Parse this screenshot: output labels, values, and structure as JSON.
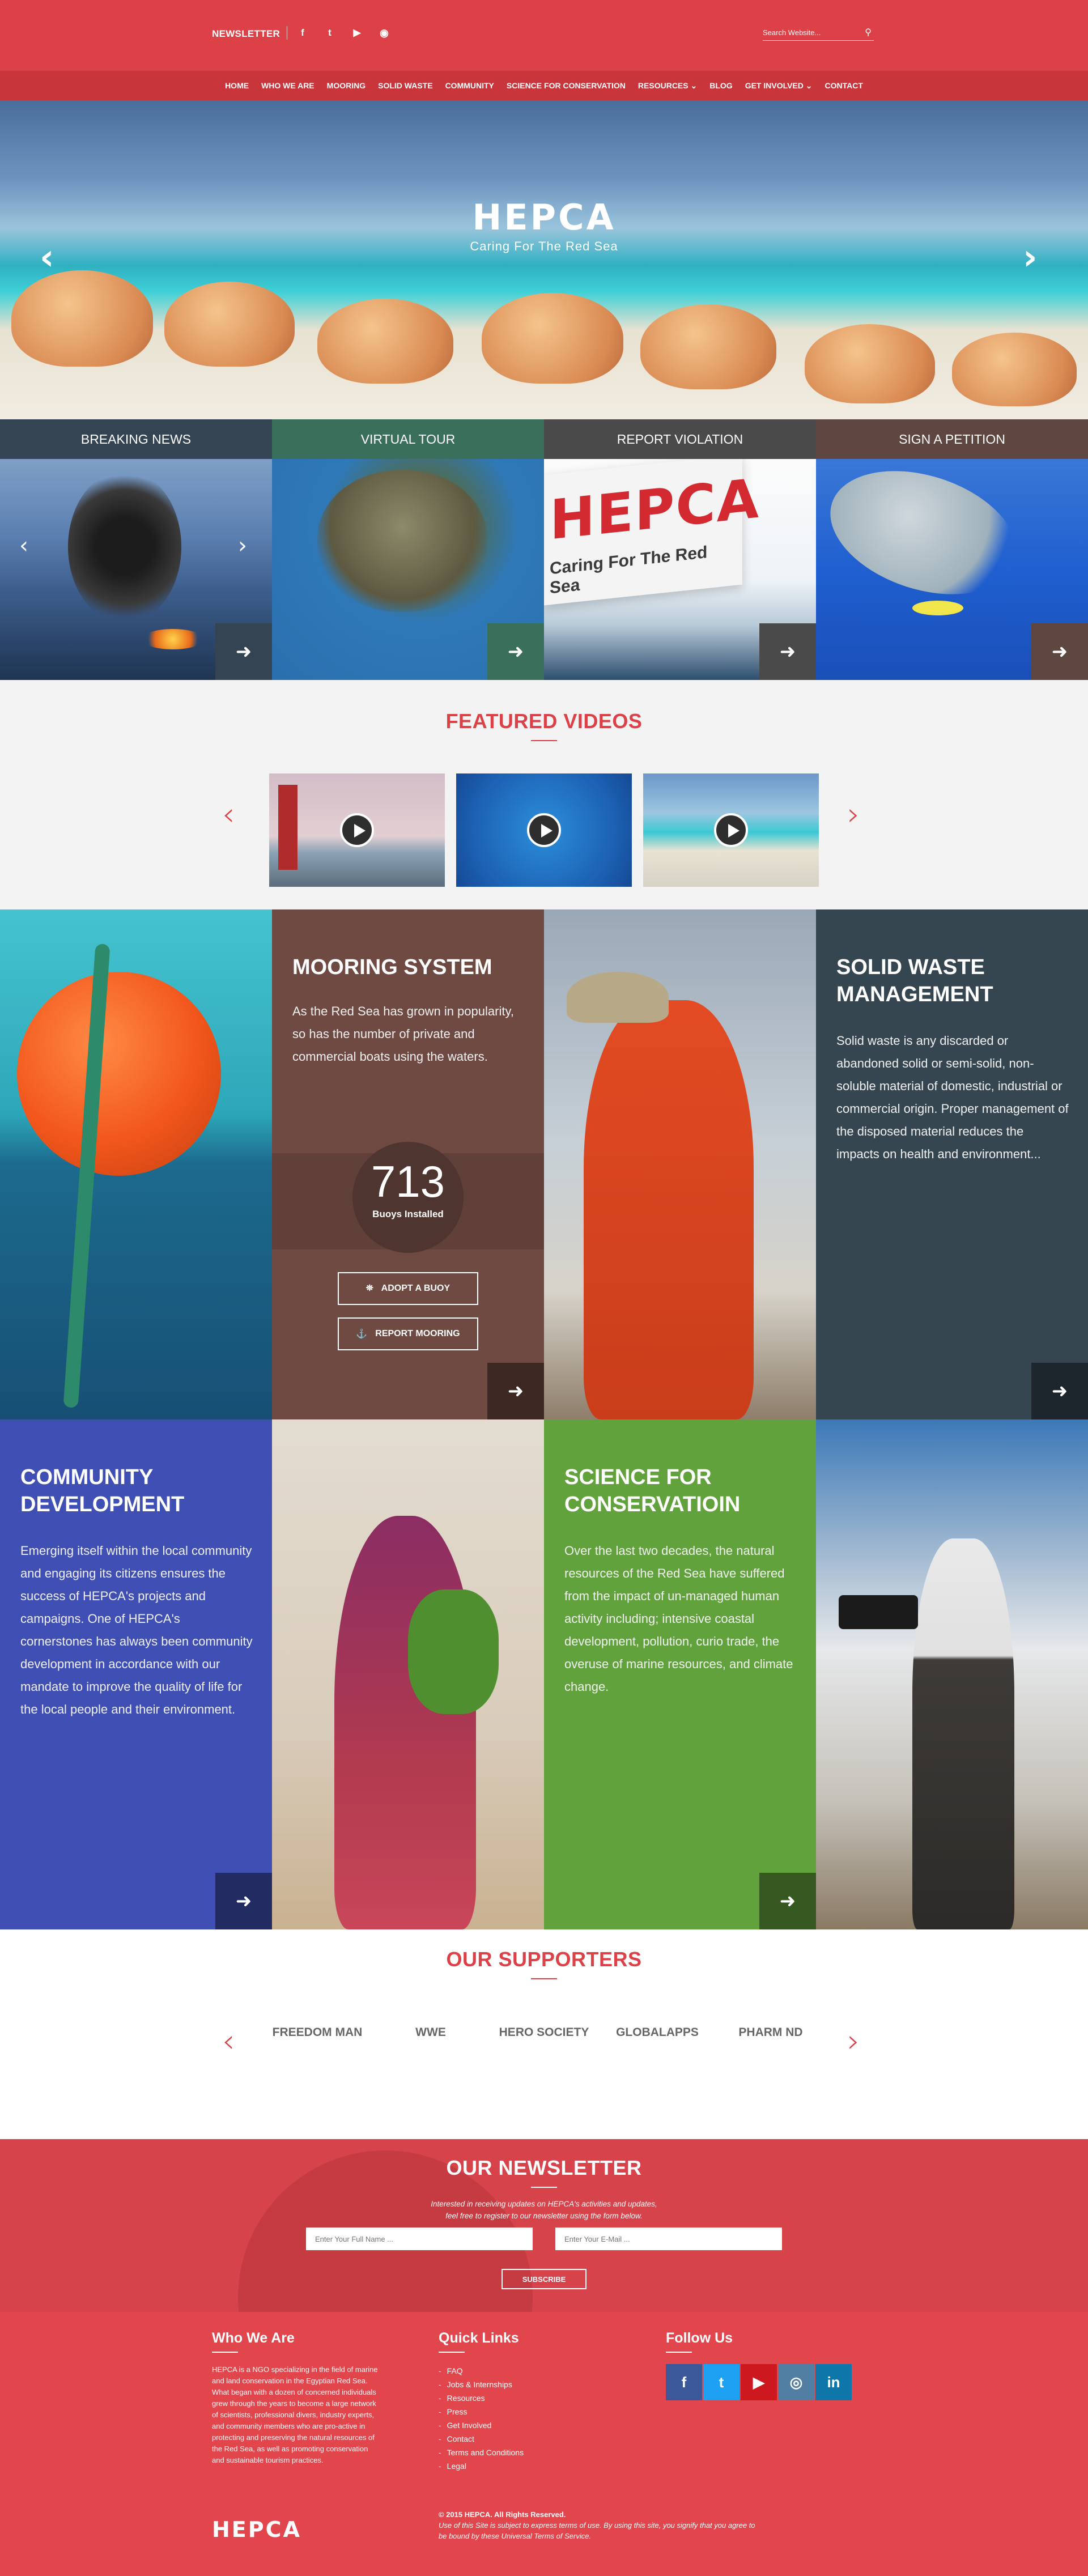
{
  "topbar": {
    "newsletter_label": "NEWSLETTER",
    "social": [
      "f",
      "t",
      "▶",
      "rss"
    ],
    "search_placeholder": "Search Website..."
  },
  "nav": [
    "HOME",
    "WHO WE ARE",
    "MOORING",
    "SOLID WASTE",
    "COMMUNITY",
    "SCIENCE FOR CONSERVATION",
    "RESOURCES ⌄",
    "BLOG",
    "GET INVOLVED ⌄",
    "CONTACT"
  ],
  "hero": {
    "logo_word": "HEPCA",
    "tagline": "Caring For The Red Sea",
    "prev": "‹",
    "next": "›"
  },
  "tiles": [
    {
      "title": "BREAKING NEWS",
      "head_color": "#344453",
      "go_color": "#344453"
    },
    {
      "title": "VIRTUAL TOUR",
      "head_color": "#3a6f5c",
      "go_color": "#3a6f5c"
    },
    {
      "title": "REPORT VIOLATION",
      "head_color": "#4a4a4a",
      "go_color": "#4a4a4a"
    },
    {
      "title": "SIGN A PETITION",
      "head_color": "#5e4741",
      "go_color": "#5e4741"
    }
  ],
  "featured_videos": {
    "title": "FEATURED VIDEOS",
    "prev": "‹",
    "next": "›"
  },
  "programs_row1": {
    "mooring": {
      "title": "MOORING SYSTEM",
      "text": "As the Red Sea has grown in popularity, so has the number of private and commercial boats using the waters.",
      "counter_value": "713",
      "counter_label": "Buoys Installed",
      "adopt_label": "ADOPT A BUOY",
      "report_label": "REPORT MOORING",
      "bg": "#6f4a43"
    },
    "solid_waste": {
      "title": "SOLID WASTE MANAGEMENT",
      "text": "Solid waste is any discarded or abandoned solid or semi-solid, non-soluble material of domestic, industrial or commercial origin. Proper management of the disposed material reduces the impacts on health and environment...",
      "bg": "#364650"
    }
  },
  "programs_row2": {
    "community": {
      "title": "COMMUNITY DEVELOPMENT",
      "text": "Emerging itself within the local community and engaging its citizens ensures the success of HEPCA's projects and campaigns. One of HEPCA's cornerstones has always been community development in accordance with our mandate to improve the quality of life for the local people and their environment.",
      "bg": "#3f4fb3"
    },
    "science": {
      "title": "SCIENCE FOR CONSERVATIOIN",
      "text": "Over the last two decades, the natural resources of the Red Sea have suffered from the impact of un-managed human activity including; intensive coastal development, pollution, curio trade, the overuse of marine resources, and climate change.",
      "bg": "#62a23c"
    }
  },
  "supporters": {
    "title": "OUR SUPPORTERS",
    "logos": [
      "FREEDOM MAN",
      "WWE",
      "HERO SOCIETY",
      "GLOBALAPPS",
      "PHARM ND"
    ],
    "prev": "‹",
    "next": "›"
  },
  "newsletter": {
    "title": "OUR NEWSLETTER",
    "intro_line1": "Interested in receiving updates on HEPCA's activities and updates,",
    "intro_line2": "feel free to register to our newsletter using the form below.",
    "name_placeholder": "Enter Your Full Name ...",
    "email_placeholder": "Enter Your E-Mail ...",
    "subscribe": "SUBSCRIBE"
  },
  "footer": {
    "who_title": "Who We Are",
    "who_text": "HEPCA is a NGO specializing in the field of marine and land conservation in the Egyptian Red Sea. What began with a dozen of concerned individuals grew through the years to become a large network of scientists, professional divers, industry experts, and community members who are pro-active in protecting and preserving the natural resources of the Red Sea, as well as promoting conservation and sustainable tourism practices.",
    "links_title": "Quick Links",
    "links": [
      "FAQ",
      "Jobs & Internships",
      "Resources",
      "Press",
      "Get Involved",
      "Contact",
      "Terms and Conditions",
      "Legal"
    ],
    "follow_title": "Follow Us",
    "follow": [
      {
        "label": "f",
        "color": "#3b5998"
      },
      {
        "label": "t",
        "color": "#1da1f2"
      },
      {
        "label": "▶",
        "color": "#cc181e"
      },
      {
        "label": "◎",
        "color": "#517fa4"
      },
      {
        "label": "in",
        "color": "#0e76a8"
      }
    ],
    "logo": "HEPCA",
    "copyright": "© 2015 HEPCA. All Rights Reserved.",
    "terms_line1": "Use of this Site is subject to express terms of use. By using this site, you signify that you agree to",
    "terms_line2": "be bound by these Universal Terms of Service."
  }
}
